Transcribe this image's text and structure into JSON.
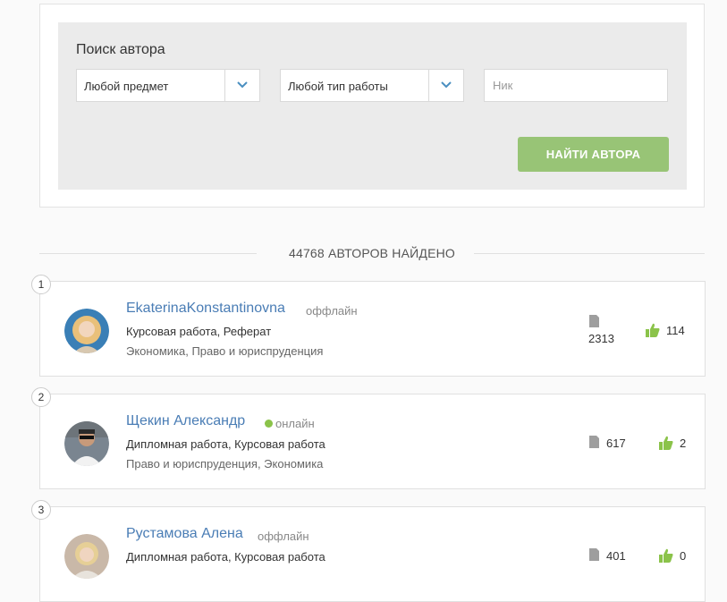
{
  "search": {
    "title": "Поиск автора",
    "subject": "Любой предмет",
    "work_type": "Любой тип работы",
    "nick_placeholder": "Ник",
    "button": "НАЙТИ АВТОРА"
  },
  "results": {
    "found_text": "44768 АВТОРОВ НАЙДЕНО"
  },
  "authors": [
    {
      "rank": "1",
      "name": "EkaterinaKonstantinovna",
      "status": "оффлайн",
      "online": false,
      "work_types": "Курсовая работа, Реферат",
      "subjects": "Экономика, Право и юриспруденция",
      "docs": "2313",
      "likes": "114"
    },
    {
      "rank": "2",
      "name": "Щекин Александр",
      "status": "онлайн",
      "online": true,
      "work_types": "Дипломная работа, Курсовая работа",
      "subjects": "Право и юриспруденция, Экономика",
      "docs": "617",
      "likes": "2"
    },
    {
      "rank": "3",
      "name": "Рустамова Алена",
      "status": "оффлайн",
      "online": false,
      "work_types": "Дипломная работа, Курсовая работа",
      "subjects": "",
      "docs": "401",
      "likes": "0"
    }
  ],
  "colors": {
    "accent": "#98c476",
    "link": "#4a7db5",
    "online": "#8bc34a",
    "chevron": "#4a8fc0"
  }
}
